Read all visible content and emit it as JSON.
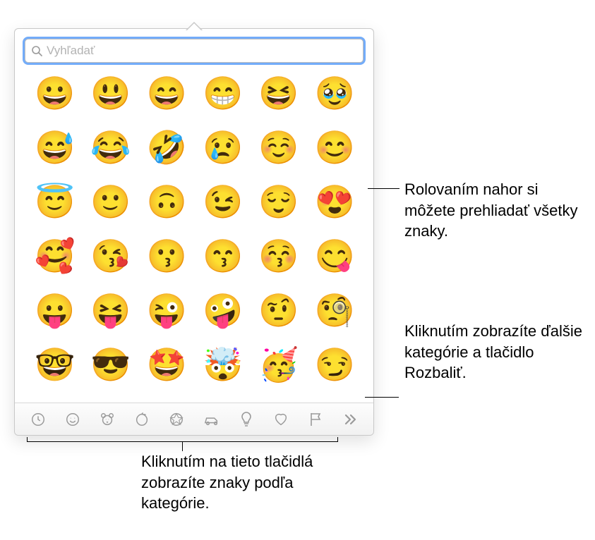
{
  "search": {
    "placeholder": "Vyhľadať"
  },
  "emojis": [
    "😀",
    "😃",
    "😄",
    "😁",
    "😆",
    "🥹",
    "😅",
    "😂",
    "🤣",
    "😢",
    "☺️",
    "😊",
    "😇",
    "🙂",
    "🙃",
    "😉",
    "😌",
    "😍",
    "🥰",
    "😘",
    "😗",
    "😙",
    "😚",
    "😋",
    "😛",
    "😝",
    "😜",
    "🤪",
    "🤨",
    "🧐",
    "🤓",
    "😎",
    "🤩",
    "🤯",
    "🥳",
    "😏"
  ],
  "categories": [
    {
      "id": "recent",
      "icon": "clock-icon"
    },
    {
      "id": "smileys",
      "icon": "smiley-icon"
    },
    {
      "id": "animals",
      "icon": "animal-icon"
    },
    {
      "id": "food",
      "icon": "food-icon"
    },
    {
      "id": "activity",
      "icon": "activity-icon"
    },
    {
      "id": "travel",
      "icon": "travel-icon"
    },
    {
      "id": "objects",
      "icon": "objects-icon"
    },
    {
      "id": "symbols",
      "icon": "heart-icon"
    },
    {
      "id": "flags",
      "icon": "flag-icon"
    },
    {
      "id": "more",
      "icon": "chevron-double-right-icon"
    }
  ],
  "callouts": {
    "scroll": "Rolovaním nahor si môžete prehliadať všetky znaky.",
    "more": "Kliknutím zobrazíte ďalšie kategórie a tlačidlo Rozbaliť.",
    "categories": "Kliknutím na tieto tlačidlá zobrazíte znaky podľa kategórie."
  }
}
